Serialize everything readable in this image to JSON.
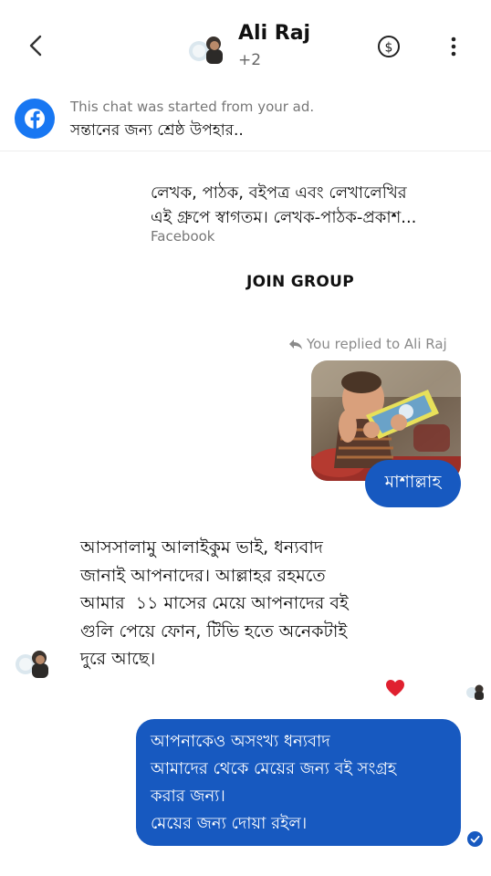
{
  "header": {
    "contact_name": "Ali Raj",
    "participants_more": "+2",
    "icons": {
      "back": "chevron-left-icon",
      "payment": "dollar-circle-icon",
      "more": "more-vertical-icon"
    }
  },
  "ad_notice": {
    "line1": "This chat was started from your ad.",
    "line2": "সন্তানের জন্য শ্রেষ্ঠ উপহার.."
  },
  "group_card": {
    "text_line1": "লেখক, পাঠক, বইপত্র এবং লেখালেখির",
    "text_line2": "এই গ্রুপে স্বাগতম। লেখক-পাঠক-প্রকাশ...",
    "source": "Facebook",
    "join_label": "JOIN GROUP"
  },
  "reply": {
    "replied_label": "You replied to Ali Raj",
    "sticker_text": "মাশাল্লাহ"
  },
  "received_message": {
    "lines": [
      "আসসালামু আলাইকুম ভাই, ধন্যবাদ",
      "জানাই আপনাদের। আল্লাহর রহমতে",
      "আমার  ১১ মাসের মেয়ে আপনাদের বই",
      "গুলি পেয়ে ফোন, টিভি হতে অনেকটাই",
      "দুরে আছে।"
    ]
  },
  "reaction": {
    "icon": "heart-icon",
    "color": "#e0202f"
  },
  "sent_message": {
    "lines": [
      "আপনাকেও অসংখ্য ধন্যবাদ",
      "আমাদের থেকে মেয়ের জন্য বই সংগ্রহ",
      "করার জন্য।",
      "মেয়ের জন্য দোয়া রইল।"
    ]
  },
  "colors": {
    "bubble": "#1759c0",
    "facebook_blue": "#1877f2"
  }
}
